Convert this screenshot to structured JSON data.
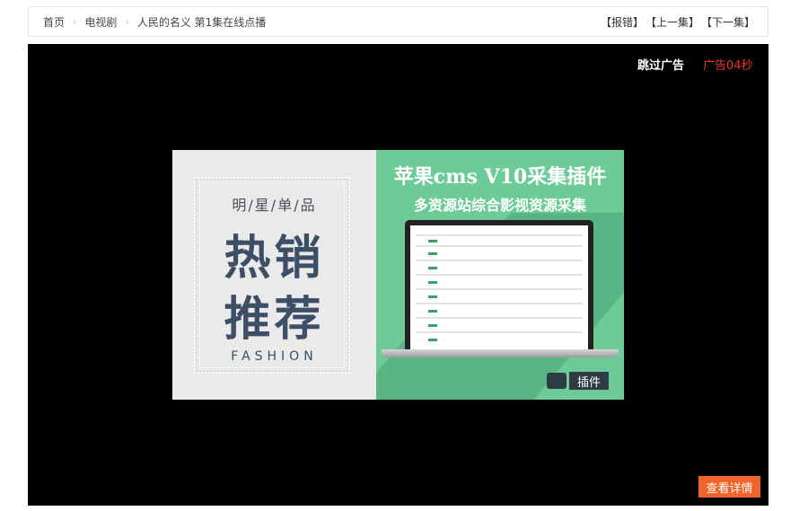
{
  "breadcrumb": {
    "items": [
      "首页",
      "电视剧",
      "人民的名义 第1集在线点播"
    ],
    "separator": "›"
  },
  "actions": {
    "report": "【报错】",
    "prev": "【上一集】",
    "next": "【下一集】"
  },
  "player": {
    "skip_ad": "跳过广告",
    "countdown": "广告04秒",
    "details_button": "查看详情"
  },
  "ad": {
    "tagline": "明/星/单/品",
    "headline_1": "热销",
    "headline_2": "推荐",
    "fashion": "FASHION",
    "title": "苹果cms V10采集插件",
    "subtitle": "多资源站综合影视资源采集",
    "badge": "插件"
  },
  "colors": {
    "accent_orange": "#f0632a",
    "countdown_red": "#e8392b",
    "ad_green": "#6dcb97"
  }
}
